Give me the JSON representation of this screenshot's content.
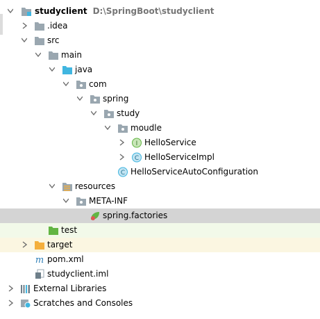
{
  "project_tree": {
    "root": {
      "name": "studyclient",
      "path": "D:\\SpringBoot\\studyclient"
    },
    "items": [
      {
        "label": "studyclient",
        "icon": "module-folder-icon"
      },
      {
        "label": ".idea",
        "icon": "folder-icon"
      },
      {
        "label": "src",
        "icon": "folder-icon"
      },
      {
        "label": "main",
        "icon": "folder-icon"
      },
      {
        "label": "java",
        "icon": "source-root-folder-icon"
      },
      {
        "label": "com",
        "icon": "package-icon"
      },
      {
        "label": "spring",
        "icon": "package-icon"
      },
      {
        "label": "study",
        "icon": "package-icon"
      },
      {
        "label": "moudle",
        "icon": "package-icon"
      },
      {
        "label": "HelloService",
        "icon": "interface-icon"
      },
      {
        "label": "HelloServiceImpl",
        "icon": "class-icon"
      },
      {
        "label": "HelloServiceAutoConfiguration",
        "icon": "class-icon"
      },
      {
        "label": "resources",
        "icon": "resources-folder-icon"
      },
      {
        "label": "META-INF",
        "icon": "package-icon"
      },
      {
        "label": "spring.factories",
        "icon": "spring-file-icon"
      },
      {
        "label": "test",
        "icon": "test-folder-icon"
      },
      {
        "label": "target",
        "icon": "excluded-folder-icon"
      },
      {
        "label": "pom.xml",
        "icon": "maven-icon"
      },
      {
        "label": "studyclient.iml",
        "icon": "iml-file-icon"
      },
      {
        "label": "External Libraries",
        "icon": "libraries-icon"
      },
      {
        "label": "Scratches and Consoles",
        "icon": "scratches-icon"
      }
    ],
    "icon_glyphs": {
      "interface": "I",
      "class": "C",
      "maven": "m"
    },
    "colors": {
      "selection": "#d4d4d4",
      "test_row": "#f2f9e9",
      "target_row": "#fbf6e1",
      "folder": "#9aa7b0",
      "source_folder": "#40b6e0",
      "test_folder": "#62b543",
      "excluded_folder": "#f4af3d",
      "class_badge": "#40b6e0",
      "interface_badge": "#62b543"
    }
  }
}
